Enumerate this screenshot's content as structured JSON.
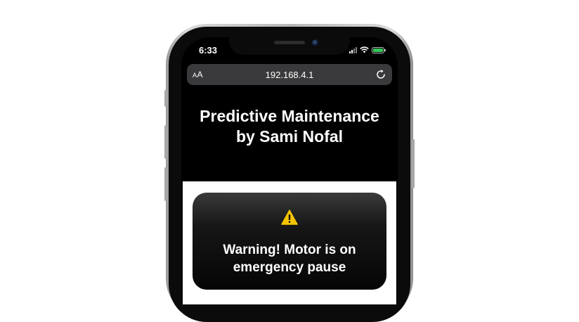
{
  "status_bar": {
    "time": "6:33"
  },
  "browser": {
    "aa_small": "A",
    "aa_large": "A",
    "url": "192.168.4.1"
  },
  "page": {
    "header_title": "Predictive Maintenance by Sami Nofal",
    "alert": {
      "icon": "warning-icon",
      "message": "Warning! Motor is on emergency pause"
    }
  },
  "colors": {
    "background": "#000000",
    "alert_icon": "#f5c400",
    "battery": "#35c759"
  }
}
